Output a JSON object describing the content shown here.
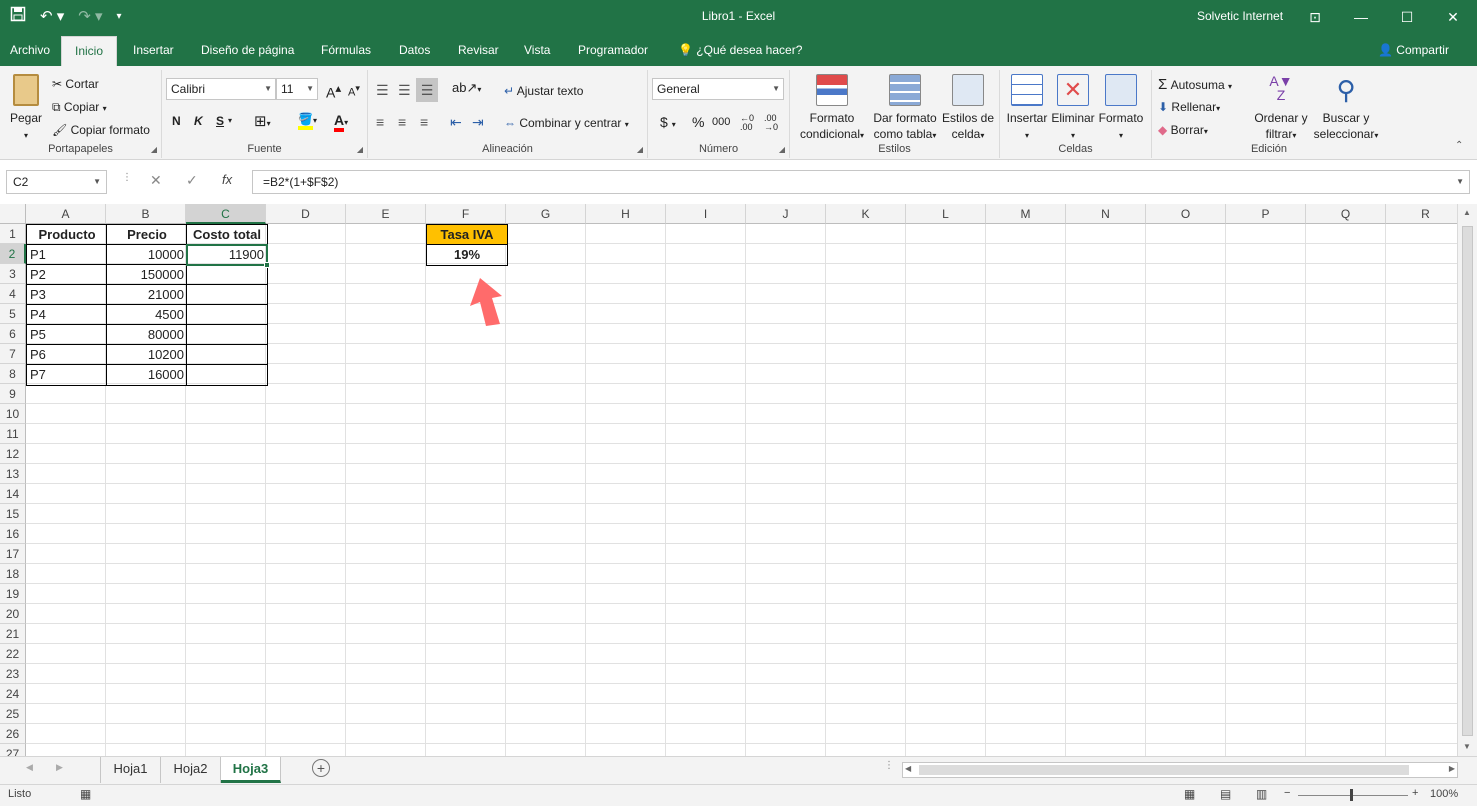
{
  "titlebar": {
    "title": "Libro1  -  Excel",
    "user": "Solvetic Internet",
    "save_icon": "save-icon",
    "undo_icon": "undo-icon",
    "redo_icon": "redo-icon"
  },
  "tabs": {
    "items": [
      "Archivo",
      "Inicio",
      "Insertar",
      "Diseño de página",
      "Fórmulas",
      "Datos",
      "Revisar",
      "Vista",
      "Programador"
    ],
    "tell_me": "¿Qué desea hacer?",
    "share": "Compartir"
  },
  "ribbon": {
    "clipboard": {
      "label": "Portapapeles",
      "paste": "Pegar",
      "cut": "Cortar",
      "copy": "Copiar",
      "format_painter": "Copiar formato"
    },
    "font": {
      "label": "Fuente",
      "name": "Calibri",
      "size": "11",
      "bold": "N",
      "italic": "K",
      "underline": "S",
      "grow": "A",
      "shrink": "A"
    },
    "alignment": {
      "label": "Alineación",
      "wrap": "Ajustar texto",
      "merge": "Combinar y centrar"
    },
    "number": {
      "label": "Número",
      "format": "General",
      "currency": "$",
      "percent": "%",
      "thousands": "000"
    },
    "styles": {
      "label": "Estilos",
      "conditional_1": "Formato",
      "conditional_2": "condicional",
      "table_1": "Dar formato",
      "table_2": "como tabla",
      "cell_1": "Estilos de",
      "cell_2": "celda"
    },
    "cells": {
      "label": "Celdas",
      "insert": "Insertar",
      "delete": "Eliminar",
      "format": "Formato"
    },
    "editing": {
      "label": "Edición",
      "autosum": "Autosuma",
      "fill": "Rellenar",
      "clear": "Borrar",
      "sort_1": "Ordenar y",
      "sort_2": "filtrar",
      "find_1": "Buscar y",
      "find_2": "seleccionar"
    }
  },
  "formula_bar": {
    "namebox": "C2",
    "fx": "fx",
    "formula": "=B2*(1+$F$2)"
  },
  "columns": [
    "A",
    "B",
    "C",
    "D",
    "E",
    "F",
    "G",
    "H",
    "I",
    "J",
    "K",
    "L",
    "M",
    "N",
    "O",
    "P",
    "Q",
    "R"
  ],
  "rows": [
    "1",
    "2",
    "3",
    "4",
    "5",
    "6",
    "7",
    "8",
    "9",
    "10",
    "11",
    "12",
    "13",
    "14",
    "15",
    "16",
    "17",
    "18",
    "19",
    "20",
    "21",
    "22",
    "23",
    "24",
    "25",
    "26",
    "27"
  ],
  "table": {
    "headers": [
      "Producto",
      "Precio",
      "Costo total"
    ],
    "rows": [
      {
        "product": "P1",
        "price": "10000",
        "total": "11900"
      },
      {
        "product": "P2",
        "price": "150000",
        "total": ""
      },
      {
        "product": "P3",
        "price": "21000",
        "total": ""
      },
      {
        "product": "P4",
        "price": "4500",
        "total": ""
      },
      {
        "product": "P5",
        "price": "80000",
        "total": ""
      },
      {
        "product": "P6",
        "price": "10200",
        "total": ""
      },
      {
        "product": "P7",
        "price": "16000",
        "total": ""
      }
    ]
  },
  "iva": {
    "label": "Tasa IVA",
    "value": "19%"
  },
  "sheets": [
    "Hoja1",
    "Hoja2",
    "Hoja3"
  ],
  "status": {
    "ready": "Listo",
    "zoom": "100%"
  },
  "colors": {
    "excel_green": "#217346",
    "iva_header": "#ffc000",
    "arrow": "#ff6b6b"
  }
}
